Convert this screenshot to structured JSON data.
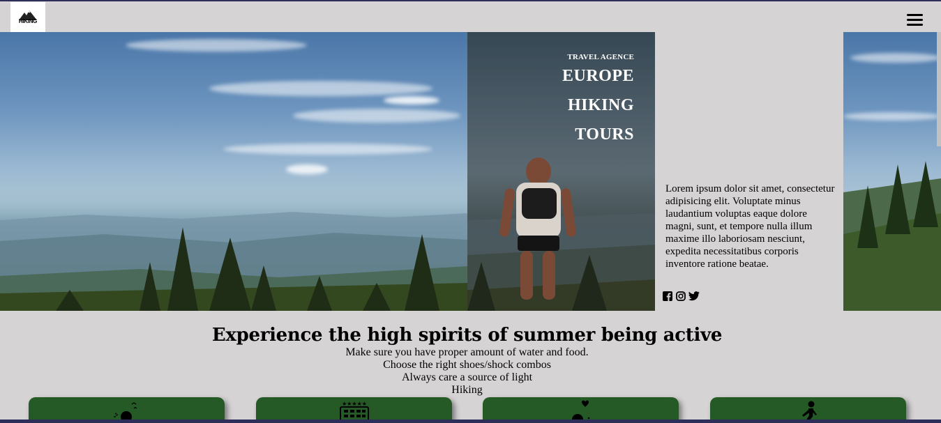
{
  "header": {
    "logo_text": "HIKING",
    "menu_icon": "hamburger-icon"
  },
  "hero": {
    "small_title": "TRAVEL AGENCE",
    "title_lines": [
      "EUROPE",
      "HIKING",
      "TOURS"
    ],
    "description": "Lorem ipsum dolor sit amet, consectetur adipisicing elit. Voluptate minus laudantium voluptas eaque dolore magni, sunt, et tempore nulla illum maxime illo laboriosam nesciunt, expedita necessitatibus corporis inventore ratione beatae.",
    "social_icons": [
      "facebook-icon",
      "instagram-icon",
      "twitter-icon"
    ]
  },
  "section": {
    "headline": "Experience the high spirits of summer being active",
    "tips": [
      "Make sure you have proper amount of water and food.",
      "Choose the right shoes/shock combos",
      "Always care a source of light",
      "Hiking"
    ]
  },
  "cards": [
    {
      "icon": "sun-birds-icon"
    },
    {
      "icon": "hotel-stars-icon"
    },
    {
      "icon": "heart-person-icon"
    },
    {
      "icon": "hiker-icon"
    }
  ],
  "colors": {
    "background": "#d6d3d4",
    "card_green": "#255a27",
    "border_navy": "#2d2f5a"
  }
}
